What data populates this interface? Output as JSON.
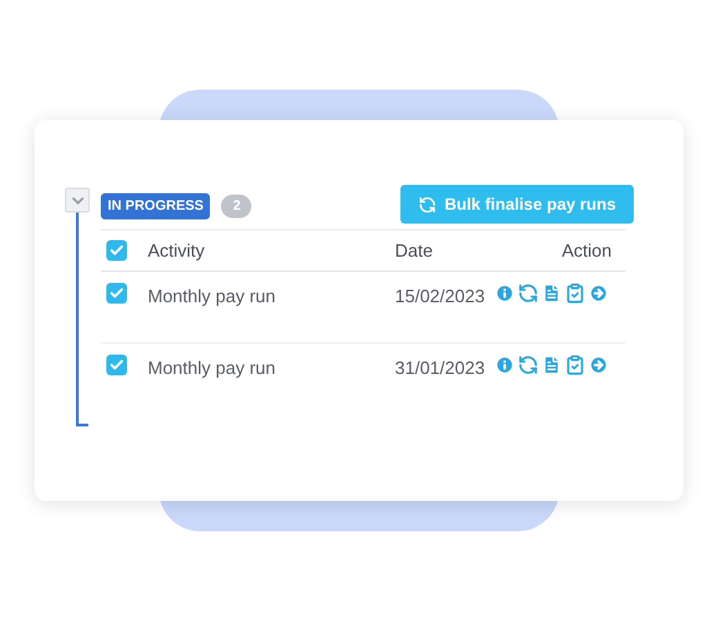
{
  "group": {
    "expanded": true,
    "status": "IN PROGRESS",
    "count": "2"
  },
  "bulk_button": {
    "label": "Bulk finalise pay runs"
  },
  "table": {
    "all_checked": true,
    "columns": [
      "Activity",
      "Date",
      "Action"
    ],
    "rows": [
      {
        "checked": true,
        "activity": "Monthly pay run",
        "date": "15/02/2023"
      },
      {
        "checked": true,
        "activity": "Monthly pay run",
        "date": "31/01/2023"
      }
    ]
  }
}
